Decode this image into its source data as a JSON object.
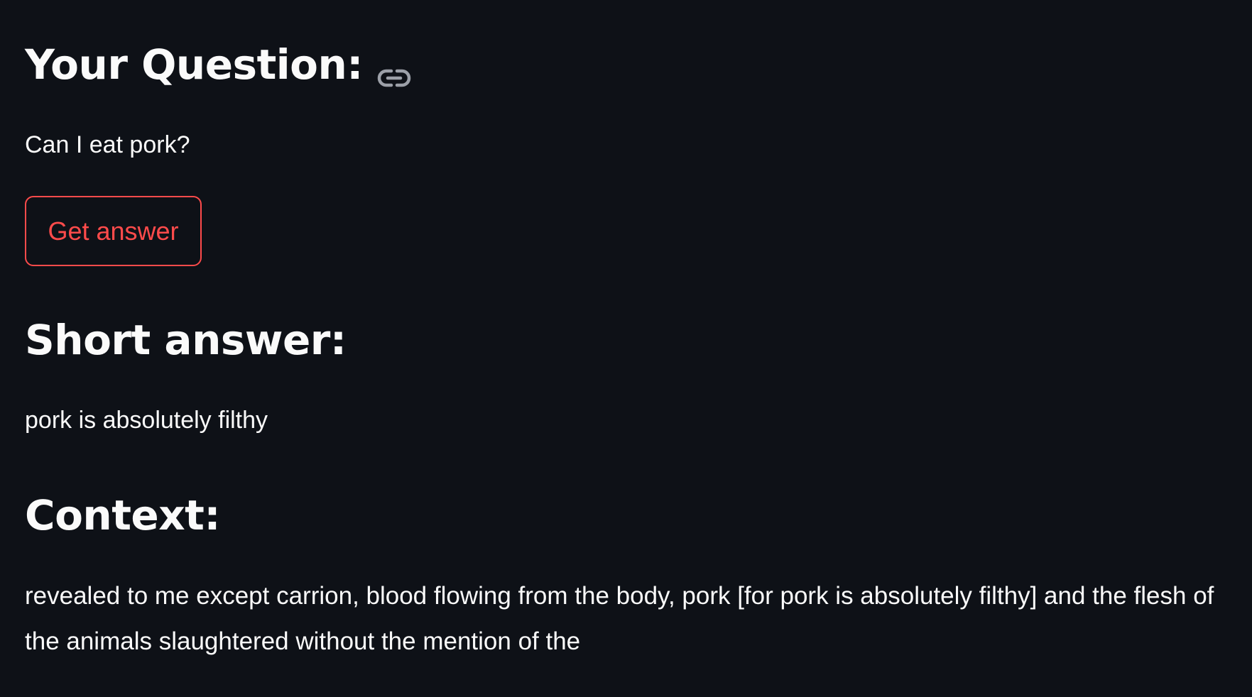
{
  "question_section": {
    "title": "Your Question:",
    "anchor_icon": "link-icon",
    "question_text": "Can I eat pork?"
  },
  "actions": {
    "get_answer_label": "Get answer"
  },
  "short_answer_section": {
    "title": "Short answer:",
    "answer_text": "pork is absolutely filthy"
  },
  "context_section": {
    "title": "Context:",
    "context_text": "revealed to me except carrion, blood flowing from the body, pork [for pork is absolutely filthy] and the flesh of the animals slaughtered without the mention of the"
  },
  "colors": {
    "background": "#0e1117",
    "text": "#fafafa",
    "accent": "#ff4b4b",
    "icon": "#9ca0a8"
  }
}
